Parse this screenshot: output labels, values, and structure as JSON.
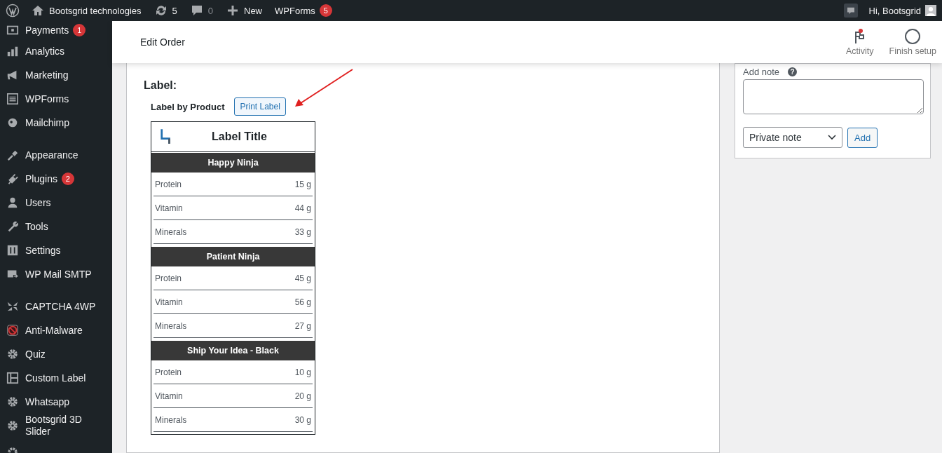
{
  "admin_bar": {
    "site": "Bootsgrid technologies",
    "updates": "5",
    "comments": "0",
    "new": "New",
    "forms": {
      "label": "WPForms",
      "badge": "5"
    },
    "greeting": "Hi, Bootsgrid"
  },
  "sidebar": {
    "groups": [
      [
        {
          "label": "Payments",
          "badge": "1"
        },
        {
          "label": "Analytics"
        },
        {
          "label": "Marketing"
        },
        {
          "label": "WPForms"
        },
        {
          "label": "Mailchimp"
        }
      ],
      [
        {
          "label": "Appearance"
        },
        {
          "label": "Plugins",
          "badge": "2"
        },
        {
          "label": "Users"
        },
        {
          "label": "Tools"
        },
        {
          "label": "Settings"
        },
        {
          "label": "WP Mail SMTP"
        }
      ],
      [
        {
          "label": "CAPTCHA 4WP"
        },
        {
          "label": "Anti-Malware"
        },
        {
          "label": "Quiz"
        },
        {
          "label": "Custom Label"
        },
        {
          "label": "Whatsapp"
        },
        {
          "label": "Bootsgrid 3D Slider"
        }
      ]
    ]
  },
  "header": {
    "title": "Edit Order",
    "actions": [
      {
        "label": "Activity",
        "notification": true
      },
      {
        "label": "Finish setup",
        "notification": false
      }
    ]
  },
  "label_section": {
    "heading": "Label:",
    "subheading": "Label by Product",
    "print_button": "Print Label",
    "card": {
      "title": "Label Title",
      "products": [
        {
          "name": "Happy Ninja",
          "nutrients": [
            {
              "name": "Protein",
              "amount": "15 g"
            },
            {
              "name": "Vitamin",
              "amount": "44 g"
            },
            {
              "name": "Minerals",
              "amount": "33 g"
            }
          ]
        },
        {
          "name": "Patient Ninja",
          "nutrients": [
            {
              "name": "Protein",
              "amount": "45 g"
            },
            {
              "name": "Vitamin",
              "amount": "56 g"
            },
            {
              "name": "Minerals",
              "amount": "27 g"
            }
          ]
        },
        {
          "name": "Ship Your Idea - Black",
          "nutrients": [
            {
              "name": "Protein",
              "amount": "10 g"
            },
            {
              "name": "Vitamin",
              "amount": "20 g"
            },
            {
              "name": "Minerals",
              "amount": "30 g"
            }
          ]
        }
      ]
    }
  },
  "notes": {
    "label": "Add note",
    "help": "?",
    "note_type": "Private note",
    "add_button": "Add"
  }
}
